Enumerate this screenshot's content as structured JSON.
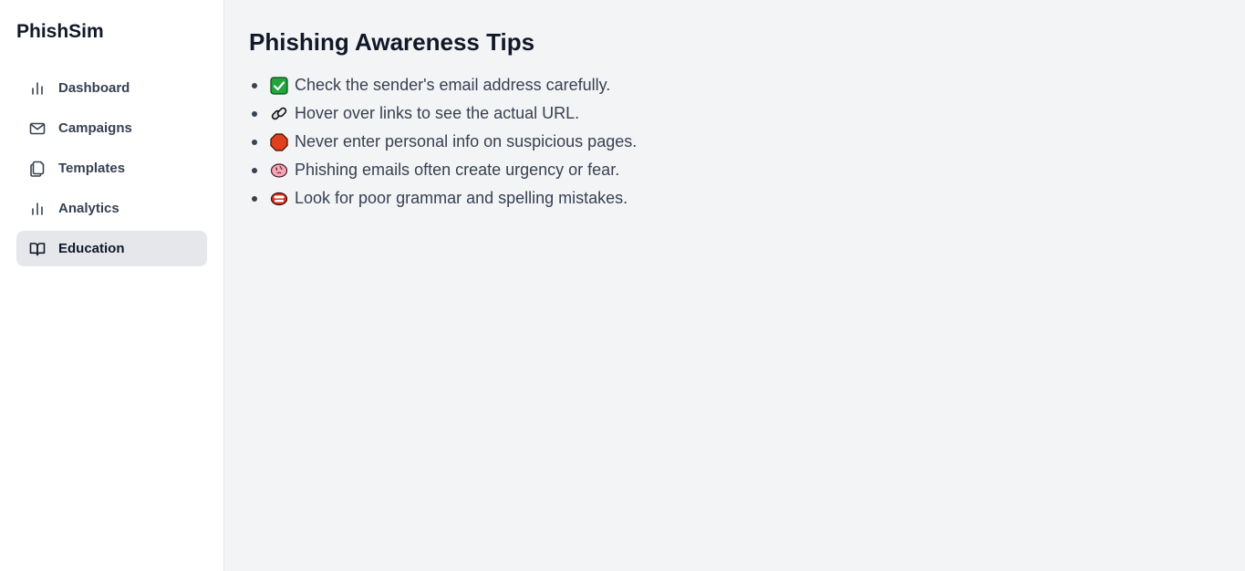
{
  "app": {
    "title": "PhishSim"
  },
  "sidebar": {
    "items": [
      {
        "label": "Dashboard",
        "icon": "bar-chart-icon",
        "active": false
      },
      {
        "label": "Campaigns",
        "icon": "mail-icon",
        "active": false
      },
      {
        "label": "Templates",
        "icon": "copy-icon",
        "active": false
      },
      {
        "label": "Analytics",
        "icon": "bar-chart-icon",
        "active": false
      },
      {
        "label": "Education",
        "icon": "book-open-icon",
        "active": true
      }
    ]
  },
  "main": {
    "title": "Phishing Awareness Tips",
    "tips": [
      {
        "emoji": "check-mark-icon",
        "text": "Check the sender's email address carefully."
      },
      {
        "emoji": "link-icon",
        "text": "Hover over links to see the actual URL."
      },
      {
        "emoji": "stop-sign-icon",
        "text": "Never enter personal info on suspicious pages."
      },
      {
        "emoji": "brain-icon",
        "text": "Phishing emails often create urgency or fear."
      },
      {
        "emoji": "mouth-icon",
        "text": "Look for poor grammar and spelling mistakes."
      }
    ]
  },
  "colors": {
    "sidebar_bg": "#ffffff",
    "main_bg": "#f3f4f6",
    "active_item_bg": "#e5e7eb",
    "text": "#374151"
  }
}
